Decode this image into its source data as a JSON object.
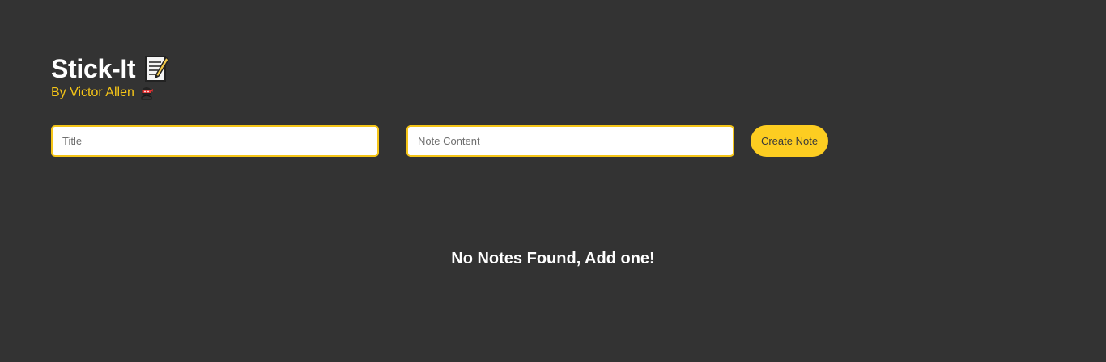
{
  "header": {
    "title": "Stick-It",
    "title_icon": "memo-icon",
    "author": "By Victor Allen",
    "author_icon": "ninja-icon"
  },
  "form": {
    "title_placeholder": "Title",
    "title_value": "",
    "content_placeholder": "Note Content",
    "content_value": "",
    "create_label": "Create Note"
  },
  "notes": [],
  "empty_message": "No Notes Found, Add one!",
  "colors": {
    "background": "#333333",
    "accent": "#fdcd21",
    "text": "#ffffff"
  }
}
